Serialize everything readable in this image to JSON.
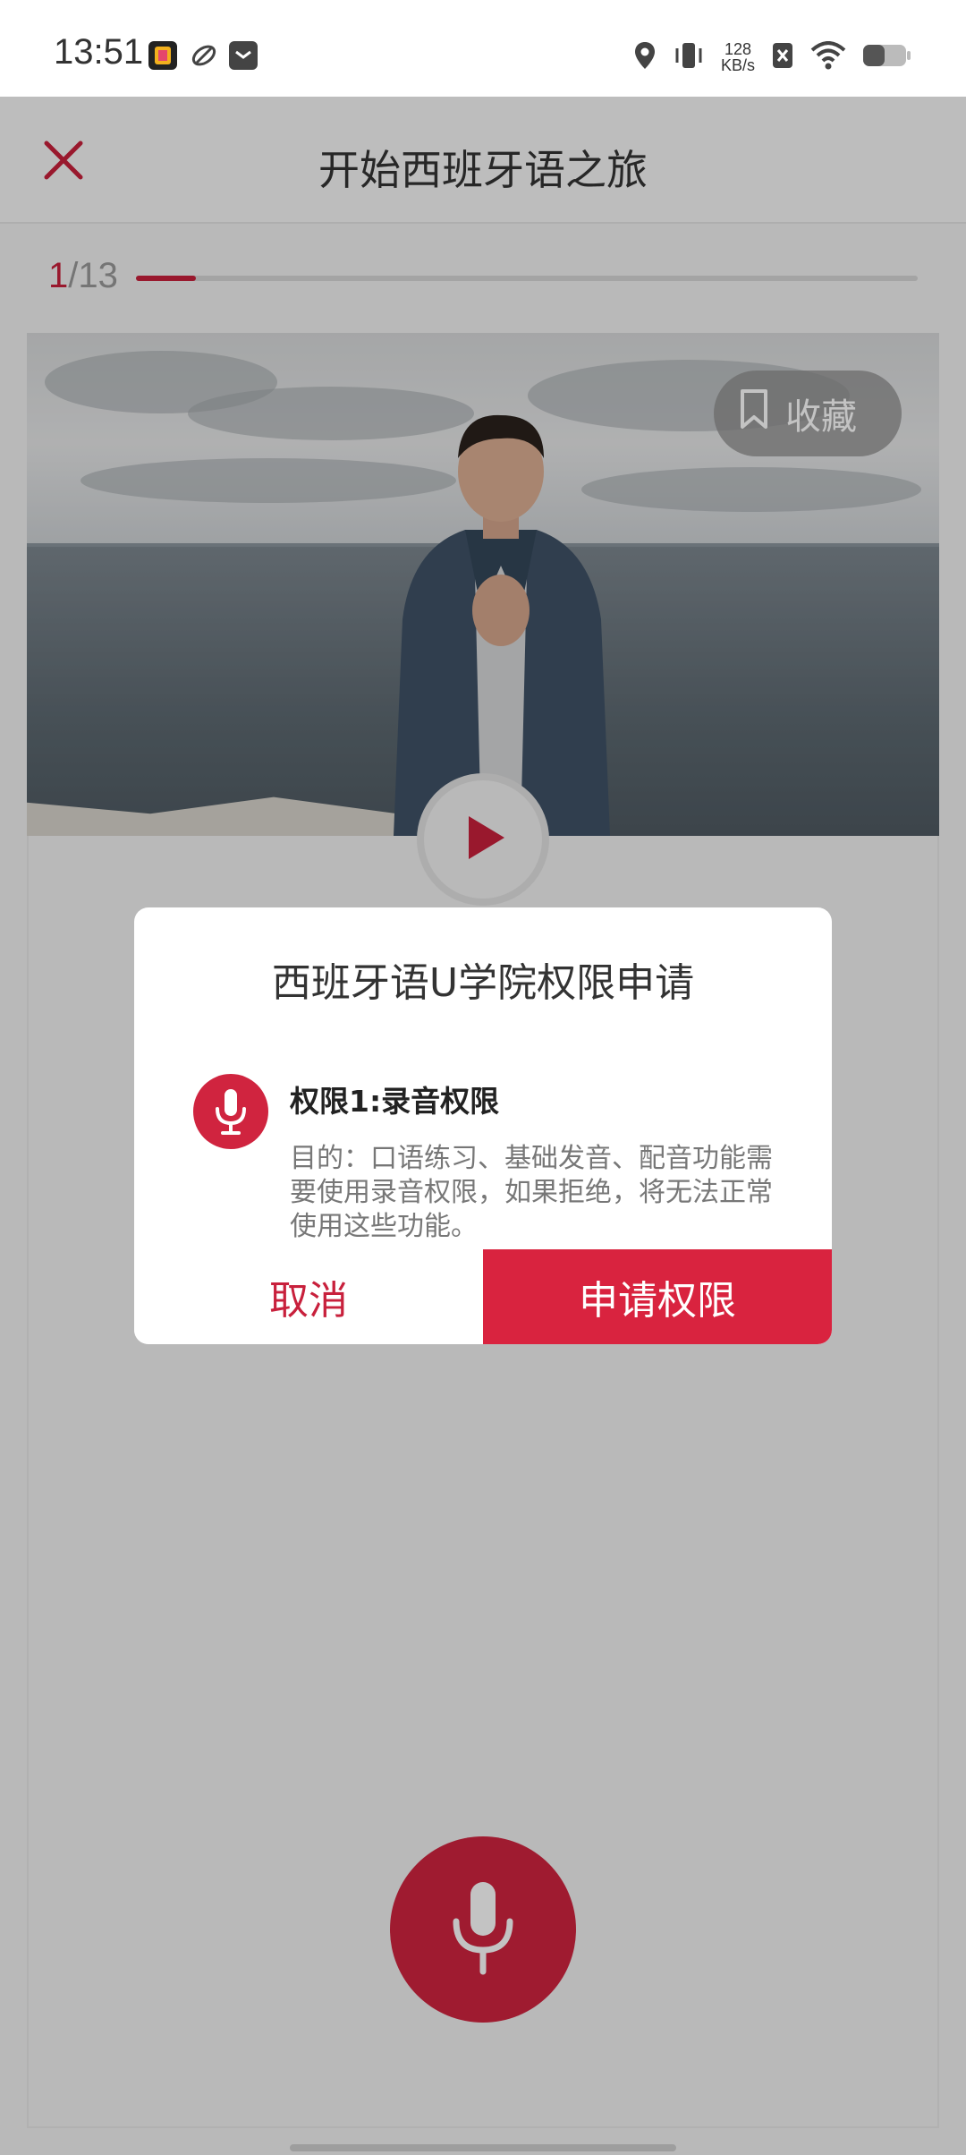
{
  "status_bar": {
    "time": "13:51",
    "net_speed_value": "128",
    "net_speed_unit": "KB/s",
    "icons": [
      "location-icon",
      "vibrate-icon",
      "no-sim-icon",
      "wifi-icon",
      "battery-icon"
    ]
  },
  "header": {
    "title": "开始西班牙语之旅",
    "close_icon": "close-icon"
  },
  "progress": {
    "current": "1",
    "total": "/13",
    "fraction": 0.077
  },
  "media": {
    "bookmark_label": "收藏",
    "play_icon": "play-icon"
  },
  "dialog": {
    "title": "西班牙语U学院权限申请",
    "permission_title": "权限1:录音权限",
    "permission_desc": "目的：口语练习、基础发音、配音功能需要使用录音权限，如果拒绝，将无法正常使用这些功能。",
    "cancel_label": "取消",
    "confirm_label": "申请权限"
  },
  "colors": {
    "accent": "#d0243f",
    "overlay": "rgba(0,0,0,0.235)"
  }
}
